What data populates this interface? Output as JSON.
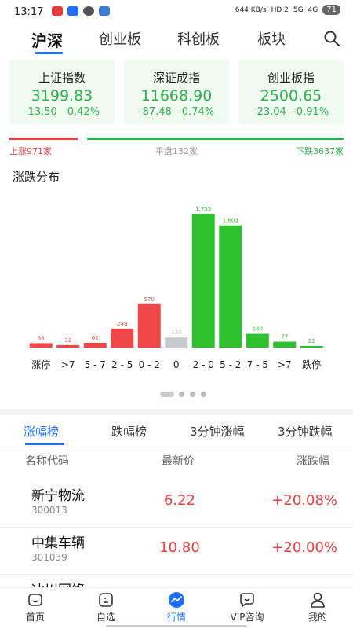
{
  "status_bar": {
    "time": "13:17",
    "net_speed": "644 KB/s",
    "signal_1": "HD 2",
    "signal_2": "5G",
    "signal_3": "4G",
    "battery": "71"
  },
  "top_tabs": [
    {
      "label": "沪深",
      "active": true
    },
    {
      "label": "创业板",
      "active": false
    },
    {
      "label": "科创板",
      "active": false
    },
    {
      "label": "板块",
      "active": false
    }
  ],
  "indices": [
    {
      "name": "上证指数",
      "value": "3199.83",
      "change": "-13.50",
      "change_pct": "-0.42%"
    },
    {
      "name": "深证成指",
      "value": "11668.90",
      "change": "-87.48",
      "change_pct": "-0.74%"
    },
    {
      "name": "创业板指",
      "value": "2500.65",
      "change": "-23.04",
      "change_pct": "-0.91%"
    }
  ],
  "breadth": {
    "up_label": "上涨971家",
    "flat_label": "平盘132家",
    "down_label": "下跌3637家",
    "up": 971,
    "flat": 132,
    "down": 3637
  },
  "distribution_title": "涨跌分布",
  "chart_data": {
    "type": "bar",
    "title": "涨跌分布",
    "categories": [
      "涨停",
      ">7",
      "5-7",
      "2-5",
      "0-2",
      "0",
      "2-0",
      "5-2",
      "7-5",
      ">7",
      "跌停"
    ],
    "values": [
      58,
      32,
      62,
      249,
      570,
      133,
      1755,
      1603,
      180,
      77,
      22
    ],
    "value_labels": [
      "58",
      "32",
      "62",
      "249",
      "570",
      "133",
      "1,755",
      "1,603",
      "180",
      "77",
      "22"
    ],
    "colors": [
      "#f04848",
      "#f04848",
      "#f04848",
      "#f04848",
      "#f04848",
      "#c8cacd",
      "#2ec02e",
      "#2ec02e",
      "#2ec02e",
      "#2ec02e",
      "#2ec02e"
    ],
    "ylim": [
      0,
      1755
    ],
    "grid": false
  },
  "page_dots": {
    "count": 4,
    "active": 0
  },
  "list_tabs": [
    {
      "label": "涨幅榜",
      "active": true
    },
    {
      "label": "跌幅榜",
      "active": false
    },
    {
      "label": "3分钟涨幅",
      "active": false
    },
    {
      "label": "3分钟跌幅",
      "active": false
    }
  ],
  "list_header": {
    "name": "名称代码",
    "price": "最新价",
    "change": "涨跌幅"
  },
  "stocks": [
    {
      "name": "新宁物流",
      "code": "300013",
      "price": "6.22",
      "change": "+20.08%"
    },
    {
      "name": "中集车辆",
      "code": "301039",
      "price": "10.80",
      "change": "+20.00%"
    },
    {
      "name": "冰川网络",
      "code": "",
      "price": "",
      "change": ""
    }
  ],
  "bottom_nav": [
    {
      "label": "首页",
      "icon": "home-icon",
      "active": false
    },
    {
      "label": "自选",
      "icon": "watchlist-icon",
      "active": false
    },
    {
      "label": "行情",
      "icon": "market-icon",
      "active": true
    },
    {
      "label": "VIP咨询",
      "icon": "chat-icon",
      "active": false
    },
    {
      "label": "我的",
      "icon": "profile-icon",
      "active": false
    }
  ],
  "colors": {
    "up": "#e84040",
    "down": "#2bb24c",
    "flat": "#c8cacd",
    "accent": "#1e6fff"
  }
}
